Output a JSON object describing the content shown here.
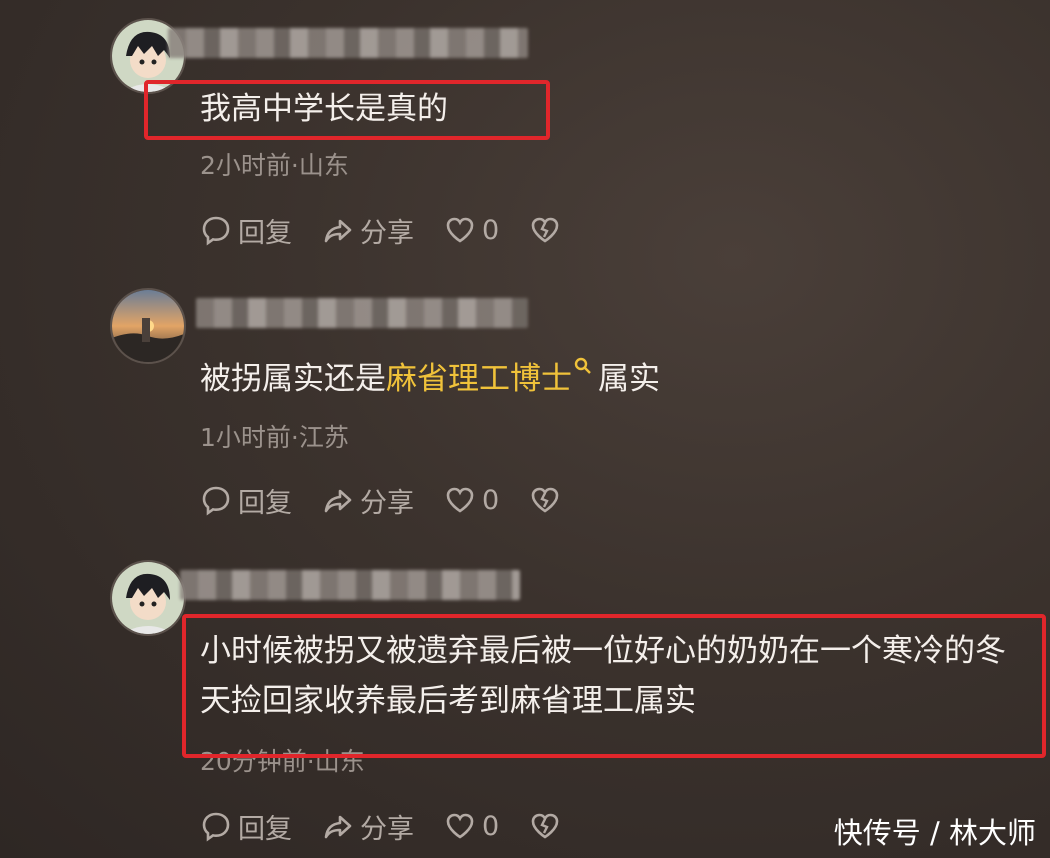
{
  "comments": [
    {
      "text": "我高中学长是真的",
      "meta": "2小时前·山东",
      "actions": {
        "reply": "回复",
        "share": "分享",
        "likes": "0"
      },
      "highlighted": true
    },
    {
      "text_before": "被拐属实还是",
      "text_link": "麻省理工博士",
      "text_after": "属实",
      "meta": "1小时前·江苏",
      "actions": {
        "reply": "回复",
        "share": "分享",
        "likes": "0"
      },
      "highlighted": false
    },
    {
      "text": "小时候被拐又被遗弃最后被一位好心的奶奶在一个寒冷的冬天捡回家收养最后考到麻省理工属实",
      "meta": "20分钟前·山东",
      "actions": {
        "reply": "回复",
        "share": "分享",
        "likes": "0"
      },
      "highlighted": true
    }
  ],
  "watermark": "快传号 / 林大师",
  "colors": {
    "background": "#3b322d",
    "highlight_box": "#e0262b",
    "link": "#f0c23a",
    "meta_text": "#9b928c"
  }
}
